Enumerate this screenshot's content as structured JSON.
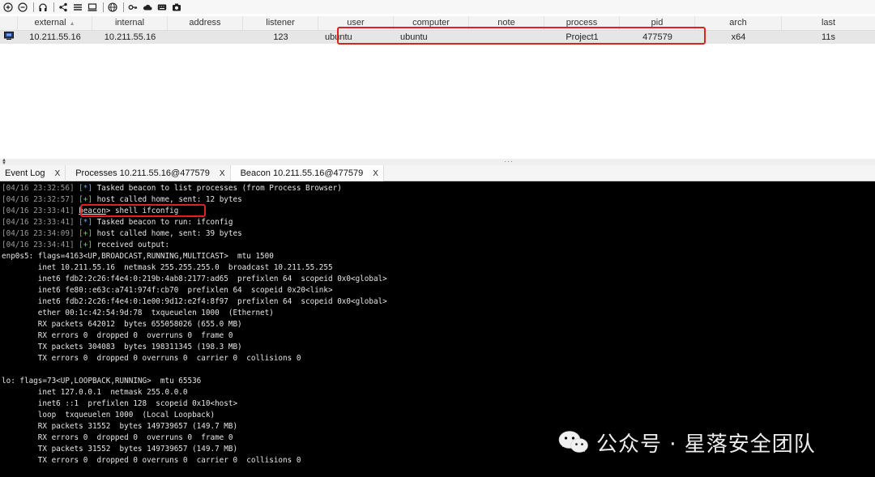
{
  "columns": [
    "external",
    "internal",
    "address",
    "listener",
    "user",
    "computer",
    "note",
    "process",
    "pid",
    "arch",
    "last"
  ],
  "row": {
    "external": "10.211.55.16",
    "internal": "10.211.55.16",
    "address": "",
    "listener": "123",
    "user": "ubuntu",
    "computer": "ubuntu",
    "note": "",
    "process": "Project1",
    "pid": "477579",
    "arch": "x64",
    "last": "11s"
  },
  "tabs": [
    {
      "label": "Event Log",
      "close": "X"
    },
    {
      "label": "Processes 10.211.55.16@477579",
      "close": "X"
    },
    {
      "label": "Beacon 10.211.55.16@477579",
      "close": "X"
    }
  ],
  "console": {
    "l1": {
      "ts": "[04/16 23:32:56]",
      "mk": "[*]",
      "text": " Tasked beacon to list processes (from Process Browser)"
    },
    "l2": {
      "ts": "[04/16 23:32:57]",
      "mk": "[+]",
      "text": " host called home, sent: 12 bytes"
    },
    "l3": {
      "ts": "[04/16 23:33:41]",
      "prompt": "beacon",
      "text": "> shell ifconfig"
    },
    "l4": {
      "ts": "[04/16 23:33:41]",
      "mk": "[*]",
      "text": " Tasked beacon to run: ifconfig"
    },
    "l5": {
      "ts": "[04/16 23:34:09]",
      "mk": "[+]",
      "text": " host called home, sent: 39 bytes"
    },
    "l6": {
      "ts": "[04/16 23:34:41]",
      "mk": "[+]",
      "text": " received output:"
    },
    "output": [
      "enp0s5: flags=4163<UP,BROADCAST,RUNNING,MULTICAST>  mtu 1500",
      "        inet 10.211.55.16  netmask 255.255.255.0  broadcast 10.211.55.255",
      "        inet6 fdb2:2c26:f4e4:0:219b:4ab8:2177:ad65  prefixlen 64  scopeid 0x0<global>",
      "        inet6 fe80::e63c:a741:974f:cb70  prefixlen 64  scopeid 0x20<link>",
      "        inet6 fdb2:2c26:f4e4:0:1e00:9d12:e2f4:8f97  prefixlen 64  scopeid 0x0<global>",
      "        ether 00:1c:42:54:9d:78  txqueuelen 1000  (Ethernet)",
      "        RX packets 642012  bytes 655058026 (655.0 MB)",
      "        RX errors 0  dropped 0  overruns 0  frame 0",
      "        TX packets 304083  bytes 198311345 (198.3 MB)",
      "        TX errors 0  dropped 0 overruns 0  carrier 0  collisions 0",
      "",
      "lo: flags=73<UP,LOOPBACK,RUNNING>  mtu 65536",
      "        inet 127.0.0.1  netmask 255.0.0.0",
      "        inet6 ::1  prefixlen 128  scopeid 0x10<host>",
      "        loop  txqueuelen 1000  (Local Loopback)",
      "        RX packets 31552  bytes 149739657 (149.7 MB)",
      "        RX errors 0  dropped 0  overruns 0  frame 0",
      "        TX packets 31552  bytes 149739657 (149.7 MB)",
      "        TX errors 0  dropped 0 overruns 0  carrier 0  collisions 0"
    ]
  },
  "watermark": "公众号 · 星落安全团队",
  "colors": {
    "highlight": "#e22020",
    "info_marker": "#6fa6ff",
    "ok_marker": "#57d957",
    "console_bg": "#000000"
  },
  "toolbar_icons": [
    "add-icon",
    "remove-icon",
    "headphones-icon",
    "share-icon",
    "list-icon",
    "monitor-icon",
    "globe-icon",
    "key-icon",
    "cloud-icon",
    "keyboard-icon",
    "camera-icon"
  ]
}
